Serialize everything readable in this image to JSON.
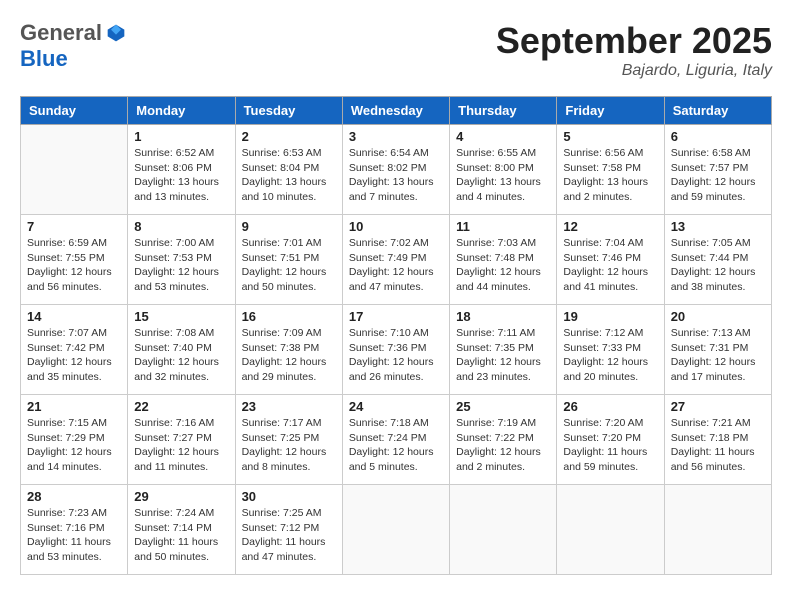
{
  "header": {
    "logo_general": "General",
    "logo_blue": "Blue",
    "month": "September 2025",
    "location": "Bajardo, Liguria, Italy"
  },
  "days_of_week": [
    "Sunday",
    "Monday",
    "Tuesday",
    "Wednesday",
    "Thursday",
    "Friday",
    "Saturday"
  ],
  "weeks": [
    [
      {
        "day": "",
        "info": ""
      },
      {
        "day": "1",
        "info": "Sunrise: 6:52 AM\nSunset: 8:06 PM\nDaylight: 13 hours\nand 13 minutes."
      },
      {
        "day": "2",
        "info": "Sunrise: 6:53 AM\nSunset: 8:04 PM\nDaylight: 13 hours\nand 10 minutes."
      },
      {
        "day": "3",
        "info": "Sunrise: 6:54 AM\nSunset: 8:02 PM\nDaylight: 13 hours\nand 7 minutes."
      },
      {
        "day": "4",
        "info": "Sunrise: 6:55 AM\nSunset: 8:00 PM\nDaylight: 13 hours\nand 4 minutes."
      },
      {
        "day": "5",
        "info": "Sunrise: 6:56 AM\nSunset: 7:58 PM\nDaylight: 13 hours\nand 2 minutes."
      },
      {
        "day": "6",
        "info": "Sunrise: 6:58 AM\nSunset: 7:57 PM\nDaylight: 12 hours\nand 59 minutes."
      }
    ],
    [
      {
        "day": "7",
        "info": "Sunrise: 6:59 AM\nSunset: 7:55 PM\nDaylight: 12 hours\nand 56 minutes."
      },
      {
        "day": "8",
        "info": "Sunrise: 7:00 AM\nSunset: 7:53 PM\nDaylight: 12 hours\nand 53 minutes."
      },
      {
        "day": "9",
        "info": "Sunrise: 7:01 AM\nSunset: 7:51 PM\nDaylight: 12 hours\nand 50 minutes."
      },
      {
        "day": "10",
        "info": "Sunrise: 7:02 AM\nSunset: 7:49 PM\nDaylight: 12 hours\nand 47 minutes."
      },
      {
        "day": "11",
        "info": "Sunrise: 7:03 AM\nSunset: 7:48 PM\nDaylight: 12 hours\nand 44 minutes."
      },
      {
        "day": "12",
        "info": "Sunrise: 7:04 AM\nSunset: 7:46 PM\nDaylight: 12 hours\nand 41 minutes."
      },
      {
        "day": "13",
        "info": "Sunrise: 7:05 AM\nSunset: 7:44 PM\nDaylight: 12 hours\nand 38 minutes."
      }
    ],
    [
      {
        "day": "14",
        "info": "Sunrise: 7:07 AM\nSunset: 7:42 PM\nDaylight: 12 hours\nand 35 minutes."
      },
      {
        "day": "15",
        "info": "Sunrise: 7:08 AM\nSunset: 7:40 PM\nDaylight: 12 hours\nand 32 minutes."
      },
      {
        "day": "16",
        "info": "Sunrise: 7:09 AM\nSunset: 7:38 PM\nDaylight: 12 hours\nand 29 minutes."
      },
      {
        "day": "17",
        "info": "Sunrise: 7:10 AM\nSunset: 7:36 PM\nDaylight: 12 hours\nand 26 minutes."
      },
      {
        "day": "18",
        "info": "Sunrise: 7:11 AM\nSunset: 7:35 PM\nDaylight: 12 hours\nand 23 minutes."
      },
      {
        "day": "19",
        "info": "Sunrise: 7:12 AM\nSunset: 7:33 PM\nDaylight: 12 hours\nand 20 minutes."
      },
      {
        "day": "20",
        "info": "Sunrise: 7:13 AM\nSunset: 7:31 PM\nDaylight: 12 hours\nand 17 minutes."
      }
    ],
    [
      {
        "day": "21",
        "info": "Sunrise: 7:15 AM\nSunset: 7:29 PM\nDaylight: 12 hours\nand 14 minutes."
      },
      {
        "day": "22",
        "info": "Sunrise: 7:16 AM\nSunset: 7:27 PM\nDaylight: 12 hours\nand 11 minutes."
      },
      {
        "day": "23",
        "info": "Sunrise: 7:17 AM\nSunset: 7:25 PM\nDaylight: 12 hours\nand 8 minutes."
      },
      {
        "day": "24",
        "info": "Sunrise: 7:18 AM\nSunset: 7:24 PM\nDaylight: 12 hours\nand 5 minutes."
      },
      {
        "day": "25",
        "info": "Sunrise: 7:19 AM\nSunset: 7:22 PM\nDaylight: 12 hours\nand 2 minutes."
      },
      {
        "day": "26",
        "info": "Sunrise: 7:20 AM\nSunset: 7:20 PM\nDaylight: 11 hours\nand 59 minutes."
      },
      {
        "day": "27",
        "info": "Sunrise: 7:21 AM\nSunset: 7:18 PM\nDaylight: 11 hours\nand 56 minutes."
      }
    ],
    [
      {
        "day": "28",
        "info": "Sunrise: 7:23 AM\nSunset: 7:16 PM\nDaylight: 11 hours\nand 53 minutes."
      },
      {
        "day": "29",
        "info": "Sunrise: 7:24 AM\nSunset: 7:14 PM\nDaylight: 11 hours\nand 50 minutes."
      },
      {
        "day": "30",
        "info": "Sunrise: 7:25 AM\nSunset: 7:12 PM\nDaylight: 11 hours\nand 47 minutes."
      },
      {
        "day": "",
        "info": ""
      },
      {
        "day": "",
        "info": ""
      },
      {
        "day": "",
        "info": ""
      },
      {
        "day": "",
        "info": ""
      }
    ]
  ]
}
